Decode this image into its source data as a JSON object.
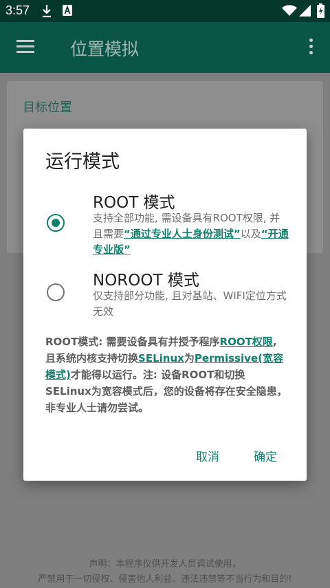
{
  "status_bar": {
    "time": "3:57",
    "icons": [
      "download-icon",
      "font-a-icon",
      "wifi-icon",
      "signal-icon",
      "battery-charging-icon"
    ]
  },
  "app_bar": {
    "title": "位置模拟",
    "icons": [
      "menu-icon",
      "more-vert-icon"
    ]
  },
  "background_card": {
    "label": "目标位置"
  },
  "dialog": {
    "title": "运行模式",
    "options": [
      {
        "title": "ROOT 模式",
        "selected": true,
        "desc_1": "支持全部功能, 需设备具有ROOT权限, 并且需要",
        "link_1": "“通过专业人士身份测试”",
        "desc_2": "以及",
        "link_2": "“开通专业版”"
      },
      {
        "title": "NOROOT 模式",
        "selected": false,
        "desc": "仅支持部分功能, 且对基站、WIFI定位方式无效"
      }
    ],
    "note": {
      "part_1": "ROOT模式: 需要设备具有并授予程序",
      "link_root": "ROOT权限",
      "part_2": ", 且系统内核支持切换",
      "link_selinux": "SELinux",
      "part_3": "为",
      "link_permissive": "Permissive(宽容模式)",
      "part_4": "才能得以运行。注: 设备ROOT和切换SELinux为宽容模式后，您的设备将存在安全隐患，非专业人士请勿尝试。"
    },
    "buttons": {
      "cancel": "取消",
      "confirm": "确定"
    }
  },
  "footer": {
    "line_1": "声明：本程序仅供开发人员调试使用，",
    "line_2": "严禁用于一切侵权、侵害他人利益、违法违禁等不当行为和目的!"
  },
  "colors": {
    "accent": "#11806c",
    "status_bar": "#06372b",
    "app_bar": "#0b5546",
    "scrim": "#7f7f7f"
  }
}
